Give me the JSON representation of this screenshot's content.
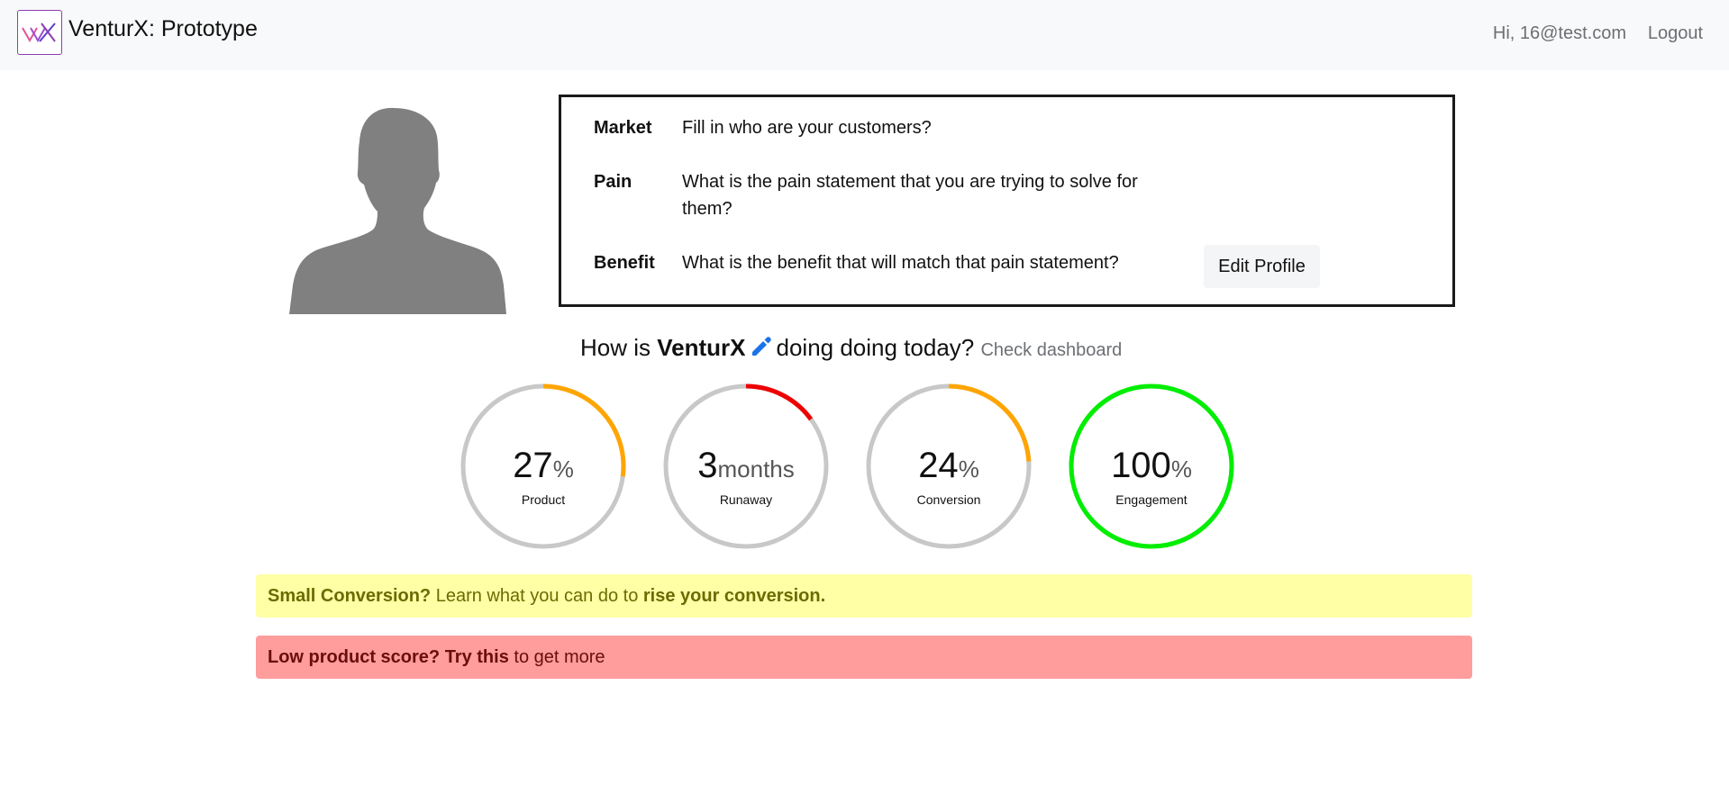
{
  "navbar": {
    "title": "VenturX: Prototype",
    "greeting": "Hi, 16@test.com",
    "logout_label": "Logout",
    "logo_icon": "venturx-logo-icon"
  },
  "profile": {
    "avatar_icon": "person-silhouette-icon",
    "market_label": "Market",
    "market_text": "Fill in who are your customers?",
    "pain_label": "Pain",
    "pain_text": "What is the pain statement that you are trying to solve for them?",
    "benefit_label": "Benefit",
    "benefit_text": "What is the benefit that will match that pain statement?",
    "edit_button": "Edit Profile"
  },
  "question": {
    "prefix": "How is",
    "company": "VenturX",
    "suffix": "doing doing today?",
    "dashboard_link": "Check dashboard",
    "edit_icon": "pencil-icon"
  },
  "gauges": [
    {
      "value": "27",
      "unit": "%",
      "label": "Product",
      "fill": 0.27,
      "color": "#ffa500"
    },
    {
      "value": "3",
      "unit": "months",
      "label": "Runaway",
      "fill": 0.15,
      "color": "#ee0000"
    },
    {
      "value": "24",
      "unit": "%",
      "label": "Conversion",
      "fill": 0.24,
      "color": "#ffa500"
    },
    {
      "value": "100",
      "unit": "%",
      "label": "Engagement",
      "fill": 1.0,
      "color": "#00ee00"
    }
  ],
  "gauge_track_color": "#c8c8c8",
  "alerts": {
    "warning": {
      "strong": "Small Conversion?",
      "text": " Learn what you can do to ",
      "link": "rise your conversion."
    },
    "danger": {
      "strong": "Low product score?",
      "link": "Try this",
      "text": " to get more"
    }
  }
}
